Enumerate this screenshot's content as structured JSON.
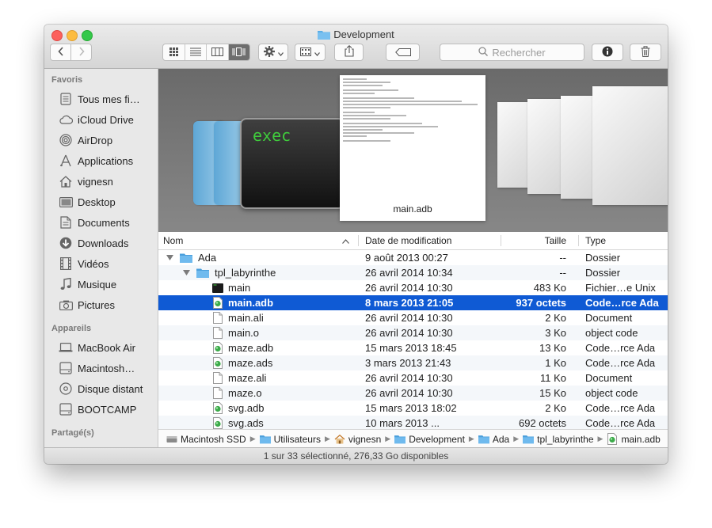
{
  "window": {
    "title": "Development"
  },
  "toolbar": {
    "search_placeholder": "Rechercher",
    "view_modes": [
      "icon-view",
      "list-view",
      "column-view",
      "cover-flow-view"
    ],
    "active_view": "cover-flow-view"
  },
  "sidebar": {
    "sections": [
      {
        "label": "Favoris",
        "items": [
          {
            "label": "Tous mes fi…",
            "icon": "all-files-icon"
          },
          {
            "label": "iCloud Drive",
            "icon": "cloud-icon"
          },
          {
            "label": "AirDrop",
            "icon": "airdrop-icon"
          },
          {
            "label": "Applications",
            "icon": "applications-icon"
          },
          {
            "label": "vignesn",
            "icon": "home-icon"
          },
          {
            "label": "Desktop",
            "icon": "desktop-icon"
          },
          {
            "label": "Documents",
            "icon": "documents-icon"
          },
          {
            "label": "Downloads",
            "icon": "downloads-icon"
          },
          {
            "label": "Vidéos",
            "icon": "film-icon"
          },
          {
            "label": "Musique",
            "icon": "music-note-icon"
          },
          {
            "label": "Pictures",
            "icon": "camera-icon"
          }
        ]
      },
      {
        "label": "Appareils",
        "items": [
          {
            "label": "MacBook Air",
            "icon": "laptop-icon"
          },
          {
            "label": "Macintosh…",
            "icon": "hard-drive-icon"
          },
          {
            "label": "Disque distant",
            "icon": "disc-icon"
          },
          {
            "label": "BOOTCAMP",
            "icon": "hard-drive-icon"
          }
        ]
      },
      {
        "label": "Partagé(s)",
        "items": []
      }
    ]
  },
  "preview": {
    "exec_label": "exec",
    "selected_caption": "main.adb"
  },
  "list": {
    "columns": {
      "name": "Nom",
      "date": "Date de modification",
      "size": "Taille",
      "kind": "Type"
    },
    "rows": [
      {
        "name": "Ada",
        "date": "9 août 2013 00:27",
        "size": "--",
        "kind": "Dossier",
        "icon": "folder-icon",
        "depth": 0,
        "expanded": true,
        "selected": false
      },
      {
        "name": "tpl_labyrinthe",
        "date": "26 avril 2014 10:34",
        "size": "--",
        "kind": "Dossier",
        "icon": "folder-icon",
        "depth": 1,
        "expanded": true,
        "selected": false
      },
      {
        "name": "main",
        "date": "26 avril 2014 10:30",
        "size": "483 Ko",
        "kind": "Fichier…e Unix",
        "icon": "terminal-exec-icon",
        "depth": 2,
        "selected": false
      },
      {
        "name": "main.adb",
        "date": "8 mars 2013 21:05",
        "size": "937 octets",
        "kind": "Code…rce Ada",
        "icon": "ada-source-icon",
        "depth": 2,
        "selected": true
      },
      {
        "name": "main.ali",
        "date": "26 avril 2014 10:30",
        "size": "2 Ko",
        "kind": "Document",
        "icon": "document-icon",
        "depth": 2,
        "selected": false
      },
      {
        "name": "main.o",
        "date": "26 avril 2014 10:30",
        "size": "3 Ko",
        "kind": "object code",
        "icon": "document-icon",
        "depth": 2,
        "selected": false
      },
      {
        "name": "maze.adb",
        "date": "15 mars 2013 18:45",
        "size": "13 Ko",
        "kind": "Code…rce Ada",
        "icon": "ada-source-icon",
        "depth": 2,
        "selected": false
      },
      {
        "name": "maze.ads",
        "date": "3 mars 2013 21:43",
        "size": "1 Ko",
        "kind": "Code…rce Ada",
        "icon": "ada-source-icon",
        "depth": 2,
        "selected": false
      },
      {
        "name": "maze.ali",
        "date": "26 avril 2014 10:30",
        "size": "11 Ko",
        "kind": "Document",
        "icon": "document-icon",
        "depth": 2,
        "selected": false
      },
      {
        "name": "maze.o",
        "date": "26 avril 2014 10:30",
        "size": "15 Ko",
        "kind": "object code",
        "icon": "document-icon",
        "depth": 2,
        "selected": false
      },
      {
        "name": "svg.adb",
        "date": "15 mars 2013 18:02",
        "size": "2 Ko",
        "kind": "Code…rce Ada",
        "icon": "ada-source-icon",
        "depth": 2,
        "selected": false
      },
      {
        "name": "svg.ads",
        "date": "10 mars 2013 ...",
        "size": "692 octets",
        "kind": "Code…rce Ada",
        "icon": "ada-source-icon",
        "depth": 2,
        "selected": false
      }
    ]
  },
  "pathbar": [
    {
      "label": "Macintosh SSD",
      "icon": "hard-drive-icon"
    },
    {
      "label": "Utilisateurs",
      "icon": "folder-icon"
    },
    {
      "label": "vignesn",
      "icon": "home-icon"
    },
    {
      "label": "Development",
      "icon": "folder-icon"
    },
    {
      "label": "Ada",
      "icon": "folder-icon"
    },
    {
      "label": "tpl_labyrinthe",
      "icon": "folder-icon"
    },
    {
      "label": "main.adb",
      "icon": "ada-source-icon"
    }
  ],
  "status": {
    "text": "1 sur 33 sélectionné, 276,33 Go disponibles"
  },
  "colors": {
    "selection": "#0f5ad4",
    "folder": "#4aa3df",
    "exec_text": "#3fcb3c"
  }
}
